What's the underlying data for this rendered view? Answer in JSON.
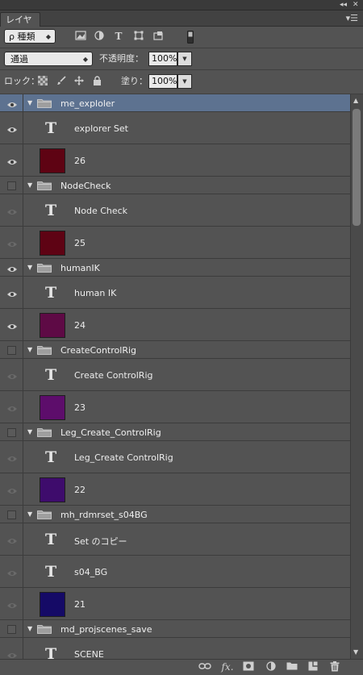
{
  "panel": {
    "tab_label": "レイヤー"
  },
  "filter_bar": {
    "kind_label": "ρ 種類"
  },
  "blend_bar": {
    "mode": "通過",
    "opacity_label": "不透明度：",
    "opacity_value": "100%"
  },
  "lock_bar": {
    "lock_label": "ロック：",
    "fill_label": "塗り：",
    "fill_value": "100%"
  },
  "layers": [
    {
      "kind": "group",
      "name": "me_exploler",
      "visible": true,
      "selected": true
    },
    {
      "kind": "text",
      "name": "explorer Set",
      "visible": true
    },
    {
      "kind": "swatch",
      "name": "26",
      "visible": true,
      "color": "#5e0313"
    },
    {
      "kind": "group",
      "name": "NodeCheck",
      "visible": false
    },
    {
      "kind": "text",
      "name": "Node Check",
      "visible": true
    },
    {
      "kind": "swatch",
      "name": "25",
      "visible": true,
      "color": "#5e0314"
    },
    {
      "kind": "group",
      "name": "humanIK",
      "visible": true
    },
    {
      "kind": "text",
      "name": "human IK",
      "visible": true
    },
    {
      "kind": "swatch",
      "name": "24",
      "visible": true,
      "color": "#5e0a45"
    },
    {
      "kind": "group",
      "name": "CreateControlRig",
      "visible": false
    },
    {
      "kind": "text",
      "name": "Create ControlRig",
      "visible": true
    },
    {
      "kind": "swatch",
      "name": "23",
      "visible": true,
      "color": "#5d0d6b"
    },
    {
      "kind": "group",
      "name": "Leg_Create_ControlRig",
      "visible": false
    },
    {
      "kind": "text",
      "name": "Leg_Create ControlRig",
      "visible": true
    },
    {
      "kind": "swatch",
      "name": "22",
      "visible": true,
      "color": "#3e0c6c"
    },
    {
      "kind": "group",
      "name": "mh_rdmrset_s04BG",
      "visible": false
    },
    {
      "kind": "text",
      "name": "Set のコピー",
      "visible": true
    },
    {
      "kind": "text",
      "name": "s04_BG",
      "visible": true
    },
    {
      "kind": "swatch",
      "name": "21",
      "visible": true,
      "color": "#150a66"
    },
    {
      "kind": "group",
      "name": "md_projscenes_save",
      "visible": false
    },
    {
      "kind": "text",
      "name": "SCENE",
      "visible": true
    }
  ],
  "bottom_bar": {
    "fx_label": "fx."
  }
}
